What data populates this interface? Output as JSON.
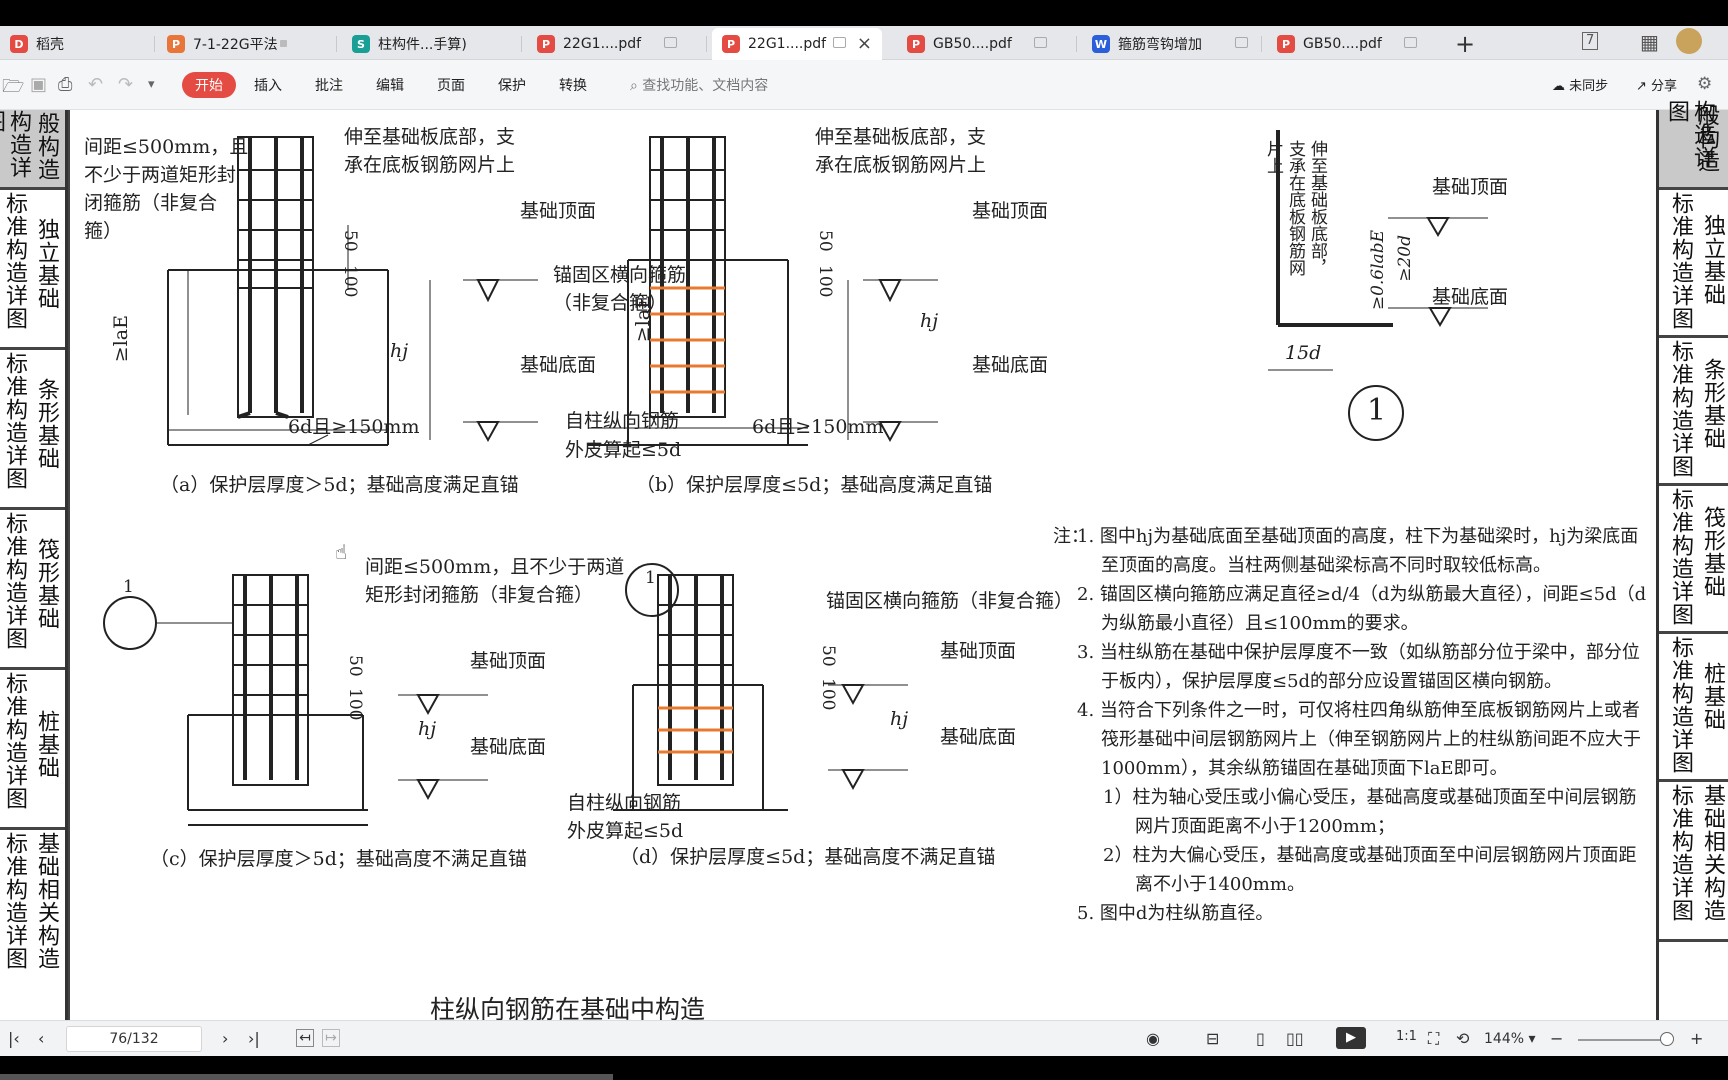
{
  "tabs": [
    {
      "label": "稻壳",
      "icon": "daoke-icon",
      "color": "#e34b43",
      "glyph": "D",
      "active": false
    },
    {
      "label": "7-1-22G平法",
      "icon": "ppt-file-icon",
      "color": "#e8763b",
      "glyph": "P",
      "active": false
    },
    {
      "label": "柱构件...手算)",
      "icon": "flow-file-icon",
      "color": "#1a9f96",
      "glyph": "S",
      "active": false
    },
    {
      "label": "22G1....pdf",
      "icon": "pdf-file-icon",
      "color": "#e34b43",
      "glyph": "P",
      "active": false
    },
    {
      "label": "22G1....pdf",
      "icon": "pdf-file-icon",
      "color": "#e34b43",
      "glyph": "P",
      "active": true
    },
    {
      "label": "GB50....pdf",
      "icon": "pdf-file-icon",
      "color": "#e34b43",
      "glyph": "P",
      "active": false
    },
    {
      "label": "箍筋弯钩增加",
      "icon": "word-file-icon",
      "color": "#2b5fd9",
      "glyph": "W",
      "active": false
    },
    {
      "label": "GB50....pdf",
      "icon": "pdf-file-icon",
      "color": "#e34b43",
      "glyph": "P",
      "active": false
    }
  ],
  "tabbar_right": {
    "num_badge": "7"
  },
  "toolbar": {
    "start": "开始",
    "menus": [
      "插入",
      "批注",
      "编辑",
      "页面",
      "保护",
      "转换"
    ],
    "search_placeholder": "查找功能、文档内容",
    "sync": "未同步",
    "share": "分享"
  },
  "sidebar_left": [
    {
      "a": "般构造",
      "b": "构造详图"
    },
    {
      "a": "独立基础",
      "b": "标准构造详图"
    },
    {
      "a": "条形基础",
      "b": "标准构造详图"
    },
    {
      "a": "筏形基础",
      "b": "标准构造详图"
    },
    {
      "a": "桩基础",
      "b": "标准构造详图"
    },
    {
      "a": "基础相关构造",
      "b": "标准构造详图"
    }
  ],
  "sidebar_right": [
    {
      "a": "般构造",
      "b": "构造详图"
    },
    {
      "a": "独立基础",
      "b": "标准构造详图"
    },
    {
      "a": "条形基础",
      "b": "标准构造详图"
    },
    {
      "a": "筏形基础",
      "b": "标准构造详图"
    },
    {
      "a": "桩基础",
      "b": "标准构造详图"
    },
    {
      "a": "基础相关构造",
      "b": "标准构造详图"
    }
  ],
  "drawing": {
    "a_note1": "间距≤500mm，且",
    "a_note2": "不少于两道矩形封",
    "a_note3": "闭箍筋（非复合",
    "a_note4": "箍）",
    "extend1": "伸至基础板底部，支",
    "extend2": "承在底板钢筋网片上",
    "top_face": "基础顶面",
    "bottom_face": "基础底面",
    "anchor_stirrup": "锚固区横向箍筋",
    "non_composite": "（非复合箍）",
    "dim_6d": "6d且≥150mm",
    "dim_50": "50",
    "dim_100": "100",
    "lae": "≥laE",
    "hj": "hj",
    "from_outer1": "自柱纵向钢筋",
    "from_outer2": "外皮算起≤5d",
    "cap_a": "（a）保护层厚度＞5d；基础高度满足直锚",
    "cap_b": "（b）保护层厚度≤5d；基础高度满足直锚",
    "cap_c": "（c）保护层厚度＞5d；基础高度不满足直锚",
    "cap_d": "（d）保护层厚度≤5d；基础高度不满足直锚",
    "c_note1": "间距≤500mm，且不少于两道",
    "c_note2": "矩形封闭箍筋（非复合箍）",
    "d_note": "锚固区横向箍筋（非复合箍）",
    "detail_extend": "伸至基础板底部，支承在底板钢筋网片上",
    "detail_06": "≥0.6labE",
    "detail_20d": "≥20d",
    "detail_15d": "15d",
    "detail_num": "1",
    "callout_num": "1",
    "title": "柱纵向钢筋在基础中构造"
  },
  "notes": {
    "head": "注：",
    "items": [
      "1. 图中hj为基础底面至基础顶面的高度，柱下为基础梁时，hj为梁底面至顶面的高度。当柱两侧基础梁标高不同时取较低标高。",
      "2. 锚固区横向箍筋应满足直径≥d/4（d为纵筋最大直径），间距≤5d（d为纵筋最小直径）且≤100mm的要求。",
      "3. 当柱纵筋在基础中保护层厚度不一致（如纵筋部分位于梁中，部分位于板内），保护层厚度≤5d的部分应设置锚固区横向钢筋。",
      "4. 当符合下列条件之一时，可仅将柱四角纵筋伸至底板钢筋网片上或者筏形基础中间层钢筋网片上（伸至钢筋网片上的柱纵筋间距不应大于1000mm），其余纵筋锚固在基础顶面下laE即可。",
      "1）柱为轴心受压或小偏心受压，基础高度或基础顶面至中间层钢筋网片顶面距离不小于1200mm；",
      "2）柱为大偏心受压，基础高度或基础顶面至中间层钢筋网片顶面距离不小于1400mm。",
      "5. 图中d为柱纵筋直径。"
    ]
  },
  "statusbar": {
    "page": "76/132",
    "zoom": "144%"
  }
}
